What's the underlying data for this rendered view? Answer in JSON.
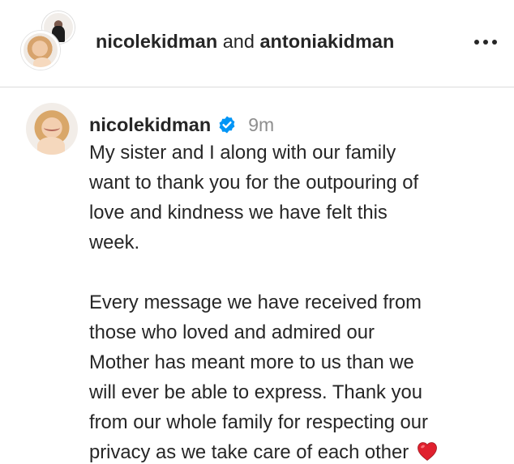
{
  "header": {
    "user_one": "nicolekidman",
    "joiner": "and",
    "user_two": "antoniakidman"
  },
  "post": {
    "username": "nicolekidman",
    "verified": true,
    "time": "9m",
    "caption_para1": "My sister and I along with our family\nwant to thank you for the outpouring of\nlove and kindness we have felt this\nweek.",
    "caption_para2": "Every message we have received from\nthose who loved and admired our\nMother has meant more to us than we\nwill ever be able to express. Thank you\nfrom our whole family for respecting our\nprivacy as we take care of each other"
  },
  "colors": {
    "verified_blue": "#0095f6",
    "heart_red": "#e0202e",
    "divider": "#dbdbdb",
    "time_gray": "#8e8e8e"
  },
  "icons": {
    "more": "more-horizontal-icon",
    "verified": "verified-badge-icon",
    "heart": "red-heart-emoji-icon"
  }
}
